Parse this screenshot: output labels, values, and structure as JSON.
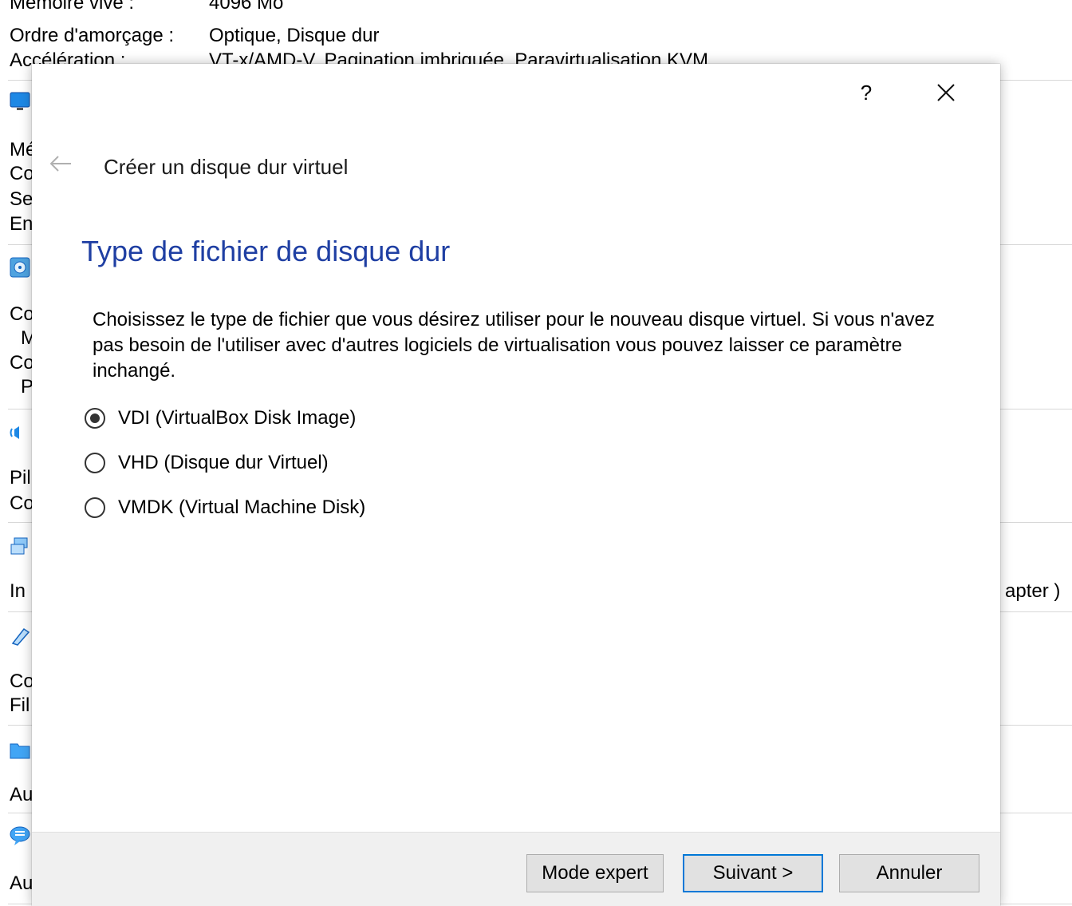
{
  "background": {
    "top_lines": [
      {
        "label": "Mémoire vive :",
        "value": "4096 Mo"
      },
      {
        "label": "Ordre d'amorçage :",
        "value": "Optique, Disque dur"
      },
      {
        "label": "Accélération :",
        "value": "VT-x/AMD-V, Pagination imbriquée, Paravirtualisation KVM"
      }
    ],
    "left_fragments": [
      "Mé",
      "Co",
      "Se",
      "En",
      "Co",
      "M",
      "Co",
      "P",
      "Pil",
      "Co",
      "In",
      "Co",
      "Fil",
      "Au",
      "Au"
    ],
    "right_fragment": "apter )"
  },
  "dialog": {
    "help_label": "?",
    "wizard_title": "Créer un disque dur virtuel",
    "page_heading": "Type de fichier de disque dur",
    "description": "Choisissez le type de fichier que vous désirez utiliser pour le nouveau disque virtuel. Si vous n'avez pas besoin de l'utiliser avec d'autres logiciels de virtualisation vous pouvez laisser ce paramètre inchangé.",
    "options": [
      {
        "label": "VDI (VirtualBox Disk Image)",
        "selected": true
      },
      {
        "label": "VHD (Disque dur Virtuel)",
        "selected": false
      },
      {
        "label": "VMDK (Virtual Machine Disk)",
        "selected": false
      }
    ],
    "buttons": {
      "expert": "Mode expert",
      "next": "Suivant >",
      "cancel": "Annuler"
    }
  },
  "colors": {
    "heading": "#1f3fa3",
    "primary_border": "#0078d7",
    "footer_bg": "#f0f0f0"
  }
}
